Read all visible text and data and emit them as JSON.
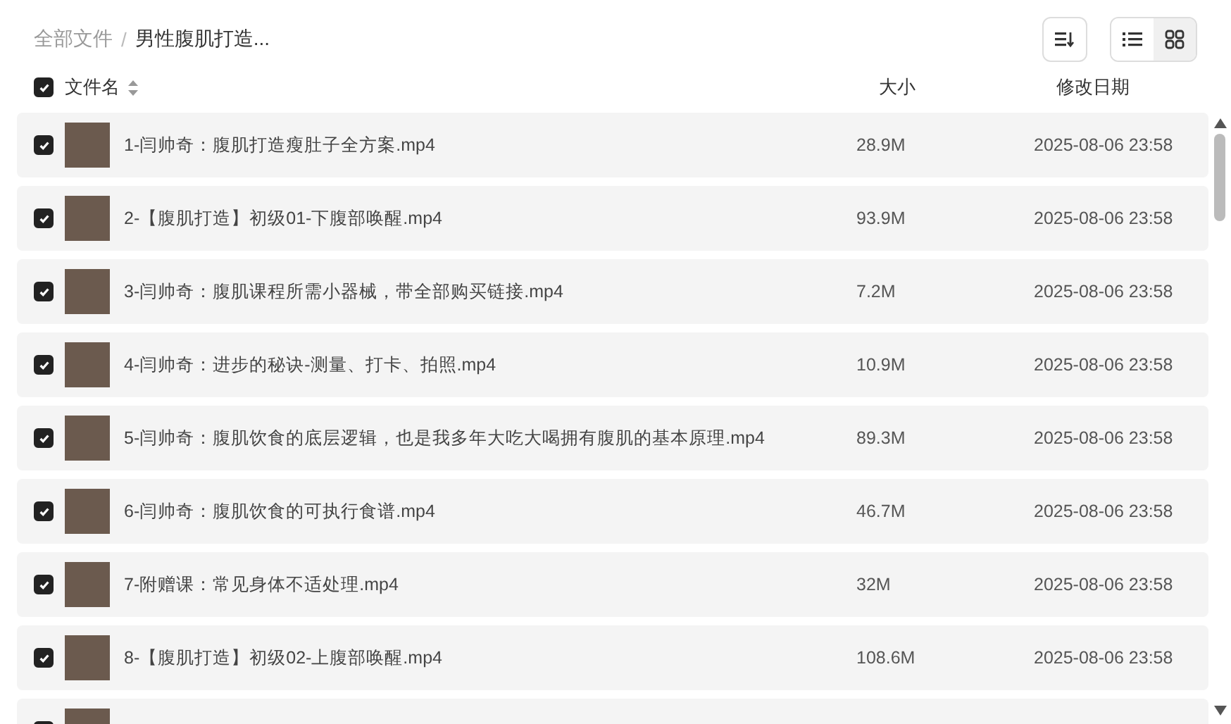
{
  "breadcrumb": [
    {
      "label": "全部文件",
      "current": false
    },
    {
      "label": "男性腹肌打造...",
      "current": true
    }
  ],
  "breadcrumb_separator": "/",
  "toolbar": {
    "view_options": [
      {
        "kind": "list",
        "selected": false
      },
      {
        "kind": "grid",
        "selected": true
      }
    ]
  },
  "table": {
    "select_all": {
      "checked": true
    },
    "columns": [
      "文件名",
      "大小",
      "修改日期"
    ],
    "rows": [
      {
        "name": "1-闫帅奇：腹肌打造瘦肚子全方案.mp4",
        "size": "28.9M",
        "modified": "2025-08-06 23:58",
        "checked": true
      },
      {
        "name": "2-【腹肌打造】初级01-下腹部唤醒.mp4",
        "size": "93.9M",
        "modified": "2025-08-06 23:58",
        "checked": true
      },
      {
        "name": "3-闫帅奇：腹肌课程所需小器械，带全部购买链接.mp4",
        "size": "7.2M",
        "modified": "2025-08-06 23:58",
        "checked": true
      },
      {
        "name": "4-闫帅奇：进步的秘诀-测量、打卡、拍照.mp4",
        "size": "10.9M",
        "modified": "2025-08-06 23:58",
        "checked": true
      },
      {
        "name": "5-闫帅奇：腹肌饮食的底层逻辑，也是我多年大吃大喝拥有腹肌的基本原理.mp4",
        "size": "89.3M",
        "modified": "2025-08-06 23:58",
        "checked": true
      },
      {
        "name": "6-闫帅奇：腹肌饮食的可执行食谱.mp4",
        "size": "46.7M",
        "modified": "2025-08-06 23:58",
        "checked": true
      },
      {
        "name": "7-附赠课：常见身体不适处理.mp4",
        "size": "32M",
        "modified": "2025-08-06 23:58",
        "checked": true
      },
      {
        "name": "8-【腹肌打造】初级02-上腹部唤醒.mp4",
        "size": "108.6M",
        "modified": "2025-08-06 23:58",
        "checked": true
      }
    ],
    "peek_row": {
      "checked": true
    }
  }
}
